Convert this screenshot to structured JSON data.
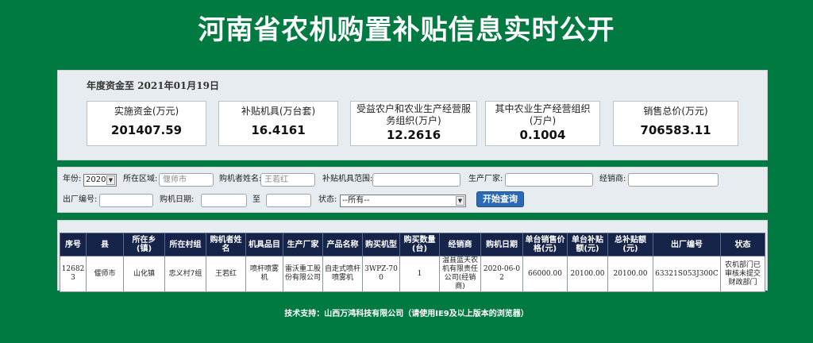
{
  "page_title": "河南省农机购置补贴信息实时公开",
  "funds": {
    "heading": "年度资金至 2021年01月19日",
    "cards": [
      {
        "label": "实施资金(万元)",
        "value": "201407.59"
      },
      {
        "label": "补贴机具(万台套)",
        "value": "16.4161"
      },
      {
        "label": "受益农户和农业生产经营服务组织(万户)",
        "value": "12.2616"
      },
      {
        "label": "其中农业生产经营组织(万户)",
        "value": "0.1004"
      },
      {
        "label": "销售总价(万元)",
        "value": "706583.11"
      }
    ]
  },
  "search": {
    "year_label": "年份:",
    "year_value": "2020",
    "area_label": "所在区域:",
    "area_value": "偃师市",
    "buyer_label": "购机者姓名:",
    "buyer_value": "王若红",
    "scope_label": "补贴机具范围:",
    "scope_value": "",
    "maker_label": "生产厂家:",
    "maker_value": "",
    "dealer_label": "经销商:",
    "dealer_value": "",
    "serial_label": "出厂编号:",
    "serial_value": "",
    "date_label": "购机日期:",
    "date_from": "",
    "date_to_label": "至",
    "date_to": "",
    "status_label": "状态:",
    "status_value": "--所有--",
    "query_button": "开始查询"
  },
  "table": {
    "headers": [
      "序号",
      "县",
      "所在乡(镇)",
      "所在村组",
      "购机者姓名",
      "机具品目",
      "生产厂家",
      "产品名称",
      "购买机型",
      "购买数量(台)",
      "经销商",
      "购机日期",
      "单台销售价格(元)",
      "单台补贴额(元)",
      "总补贴额(元)",
      "出厂编号",
      "状态"
    ],
    "rows": [
      [
        "126823",
        "偃师市",
        "山化镇",
        "忠义村7组",
        "王若红",
        "喷杆喷雾机",
        "雷沃重工股份有限公司",
        "自走式喷杆喷雾机",
        "3WPZ-700",
        "1",
        "温县蓝天农机有限责任公司(经销商)",
        "2020-06-02",
        "66000.00",
        "20100.00",
        "20100.00",
        "63321S053J300C",
        "农机部门已审核未提交财政部门"
      ]
    ]
  },
  "footer": "技术支持：山西万鸿科技有限公司（请使用IE9及以上版本的浏览器）"
}
